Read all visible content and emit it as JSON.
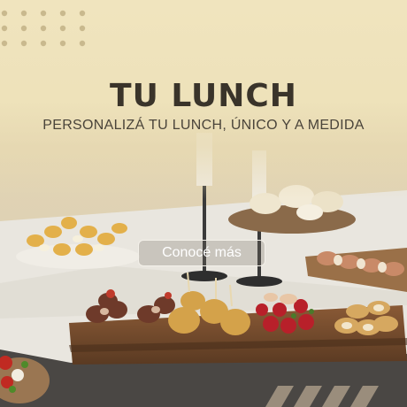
{
  "banner": {
    "title": "TU LUNCH",
    "subtitle": "PERSONALIZÁ TU LUNCH, ÚNICO Y A MEDIDA",
    "cta_label": "Conocé más"
  },
  "colors": {
    "cream": "#efe3bd",
    "title": "#3a342a",
    "dots": "#c9b98e",
    "stripes": "#a89a86"
  },
  "image": {
    "description_icon": "catering-photo"
  }
}
